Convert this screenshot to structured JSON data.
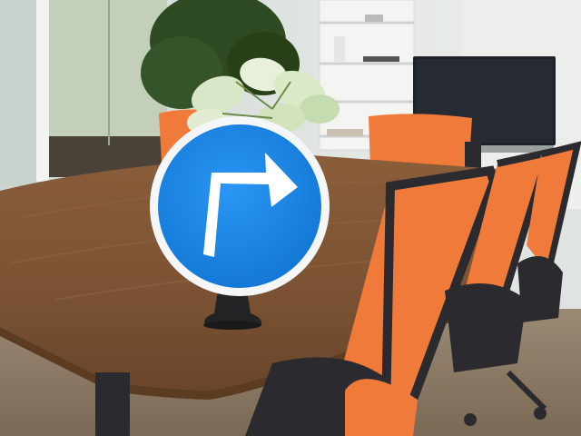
{
  "scene": {
    "colors": {
      "wall": "#e4e8e6",
      "glass_room": "#b9c7b4",
      "floor": "#8a7a66",
      "table_top": "#7a5233",
      "table_edge": "#5c3b23",
      "chair_mesh": "#f07a3a",
      "chair_frame": "#2b2b2f",
      "shelf": "#f3f4f2",
      "tv": "#1e2228",
      "plant_dark": "#2e4a22",
      "plant_light": "#e8f0da",
      "sign_blue": "#1a86e8",
      "sign_rim": "#f4f6f8",
      "arrow": "#ffffff",
      "sign_stand": "#222325"
    },
    "objects": [
      "meeting-room",
      "conference-table",
      "office-chairs",
      "potted-plant",
      "bookshelf",
      "television",
      "traffic-sign-turn-right"
    ]
  }
}
